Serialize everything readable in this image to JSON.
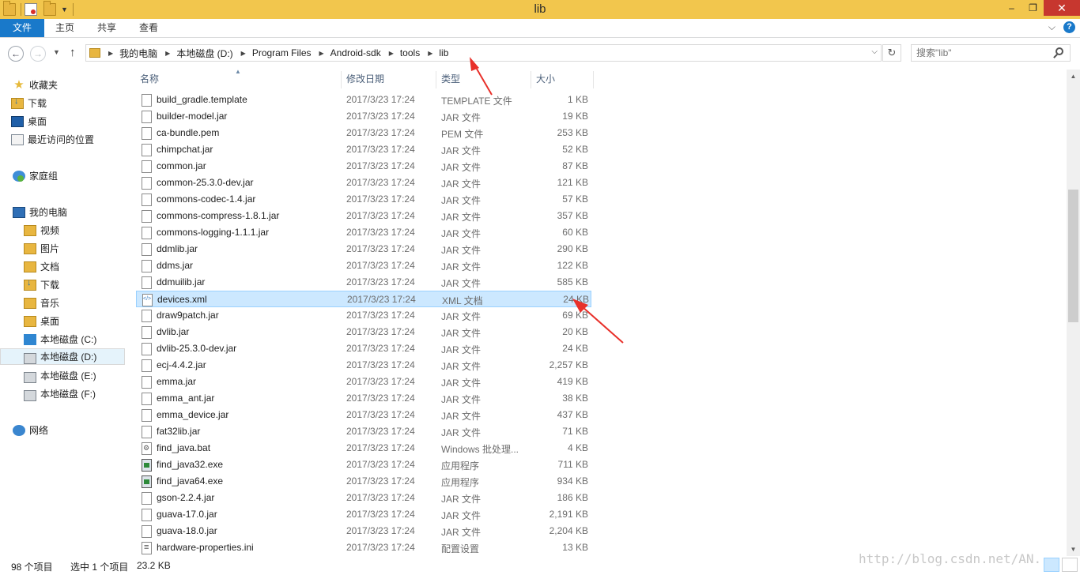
{
  "window": {
    "title": "lib",
    "controls": {
      "minimize": "–",
      "maximize": "❐",
      "close": "✕"
    }
  },
  "ribbon": {
    "tabs": [
      "文件",
      "主页",
      "共享",
      "查看"
    ],
    "help": "?"
  },
  "address": {
    "breadcrumb": [
      "我的电脑",
      "本地磁盘 (D:)",
      "Program Files",
      "Android-sdk",
      "tools",
      "lib"
    ],
    "search_placeholder": "搜索\"lib\""
  },
  "nav": {
    "favorites": {
      "label": "收藏夹",
      "items": [
        "下载",
        "桌面",
        "最近访问的位置"
      ]
    },
    "homegroup": {
      "label": "家庭组"
    },
    "computer": {
      "label": "我的电脑",
      "items": [
        "视频",
        "图片",
        "文档",
        "下载",
        "音乐",
        "桌面",
        "本地磁盘 (C:)",
        "本地磁盘 (D:)",
        "本地磁盘 (E:)",
        "本地磁盘 (F:)"
      ]
    },
    "network": {
      "label": "网络"
    }
  },
  "columns": {
    "name": "名称",
    "date": "修改日期",
    "type": "类型",
    "size": "大小"
  },
  "files": [
    {
      "name": "build_gradle.template",
      "date": "2017/3/23 17:24",
      "type": "TEMPLATE 文件",
      "size": "1 KB",
      "icon": "file"
    },
    {
      "name": "builder-model.jar",
      "date": "2017/3/23 17:24",
      "type": "JAR 文件",
      "size": "19 KB",
      "icon": "file"
    },
    {
      "name": "ca-bundle.pem",
      "date": "2017/3/23 17:24",
      "type": "PEM 文件",
      "size": "253 KB",
      "icon": "file"
    },
    {
      "name": "chimpchat.jar",
      "date": "2017/3/23 17:24",
      "type": "JAR 文件",
      "size": "52 KB",
      "icon": "file"
    },
    {
      "name": "common.jar",
      "date": "2017/3/23 17:24",
      "type": "JAR 文件",
      "size": "87 KB",
      "icon": "file"
    },
    {
      "name": "common-25.3.0-dev.jar",
      "date": "2017/3/23 17:24",
      "type": "JAR 文件",
      "size": "121 KB",
      "icon": "file"
    },
    {
      "name": "commons-codec-1.4.jar",
      "date": "2017/3/23 17:24",
      "type": "JAR 文件",
      "size": "57 KB",
      "icon": "file"
    },
    {
      "name": "commons-compress-1.8.1.jar",
      "date": "2017/3/23 17:24",
      "type": "JAR 文件",
      "size": "357 KB",
      "icon": "file"
    },
    {
      "name": "commons-logging-1.1.1.jar",
      "date": "2017/3/23 17:24",
      "type": "JAR 文件",
      "size": "60 KB",
      "icon": "file"
    },
    {
      "name": "ddmlib.jar",
      "date": "2017/3/23 17:24",
      "type": "JAR 文件",
      "size": "290 KB",
      "icon": "file"
    },
    {
      "name": "ddms.jar",
      "date": "2017/3/23 17:24",
      "type": "JAR 文件",
      "size": "122 KB",
      "icon": "file"
    },
    {
      "name": "ddmuilib.jar",
      "date": "2017/3/23 17:24",
      "type": "JAR 文件",
      "size": "585 KB",
      "icon": "file"
    },
    {
      "name": "devices.xml",
      "date": "2017/3/23 17:24",
      "type": "XML 文档",
      "size": "24 KB",
      "icon": "xml",
      "selected": true
    },
    {
      "name": "draw9patch.jar",
      "date": "2017/3/23 17:24",
      "type": "JAR 文件",
      "size": "69 KB",
      "icon": "file"
    },
    {
      "name": "dvlib.jar",
      "date": "2017/3/23 17:24",
      "type": "JAR 文件",
      "size": "20 KB",
      "icon": "file"
    },
    {
      "name": "dvlib-25.3.0-dev.jar",
      "date": "2017/3/23 17:24",
      "type": "JAR 文件",
      "size": "24 KB",
      "icon": "file"
    },
    {
      "name": "ecj-4.4.2.jar",
      "date": "2017/3/23 17:24",
      "type": "JAR 文件",
      "size": "2,257 KB",
      "icon": "file"
    },
    {
      "name": "emma.jar",
      "date": "2017/3/23 17:24",
      "type": "JAR 文件",
      "size": "419 KB",
      "icon": "file"
    },
    {
      "name": "emma_ant.jar",
      "date": "2017/3/23 17:24",
      "type": "JAR 文件",
      "size": "38 KB",
      "icon": "file"
    },
    {
      "name": "emma_device.jar",
      "date": "2017/3/23 17:24",
      "type": "JAR 文件",
      "size": "437 KB",
      "icon": "file"
    },
    {
      "name": "fat32lib.jar",
      "date": "2017/3/23 17:24",
      "type": "JAR 文件",
      "size": "71 KB",
      "icon": "file"
    },
    {
      "name": "find_java.bat",
      "date": "2017/3/23 17:24",
      "type": "Windows 批处理...",
      "size": "4 KB",
      "icon": "bat"
    },
    {
      "name": "find_java32.exe",
      "date": "2017/3/23 17:24",
      "type": "应用程序",
      "size": "711 KB",
      "icon": "exe"
    },
    {
      "name": "find_java64.exe",
      "date": "2017/3/23 17:24",
      "type": "应用程序",
      "size": "934 KB",
      "icon": "exe"
    },
    {
      "name": "gson-2.2.4.jar",
      "date": "2017/3/23 17:24",
      "type": "JAR 文件",
      "size": "186 KB",
      "icon": "file"
    },
    {
      "name": "guava-17.0.jar",
      "date": "2017/3/23 17:24",
      "type": "JAR 文件",
      "size": "2,191 KB",
      "icon": "file"
    },
    {
      "name": "guava-18.0.jar",
      "date": "2017/3/23 17:24",
      "type": "JAR 文件",
      "size": "2,204 KB",
      "icon": "file"
    },
    {
      "name": "hardware-properties.ini",
      "date": "2017/3/23 17:24",
      "type": "配置设置",
      "size": "13 KB",
      "icon": "ini"
    }
  ],
  "status": {
    "item_count": "98 个项目",
    "selection": "选中 1 个项目",
    "selection_size": "23.2 KB"
  },
  "watermark": "http://blog.csdn.net/AN...",
  "colors": {
    "titlebar": "#f2c64d",
    "file_tab": "#1979ca",
    "selection": "#cce8ff",
    "arrow": "#e8302a"
  }
}
